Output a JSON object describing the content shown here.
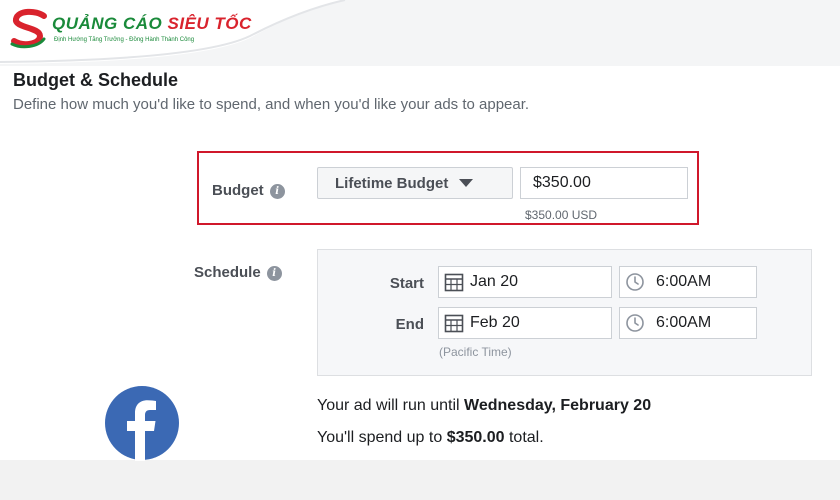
{
  "branding": {
    "name_part1": "QUẢNG CÁO",
    "name_part2": "SIÊU TỐC",
    "tagline": "Định Hướng Tăng Trưởng - Đồng Hành Thành Công",
    "colors": {
      "green": "#1a8a3a",
      "red": "#d9232d"
    }
  },
  "section": {
    "title": "Budget & Schedule",
    "subtitle": "Define how much you'd like to spend, and when you'd like your ads to appear."
  },
  "budget": {
    "label": "Budget",
    "type_dropdown": "Lifetime Budget",
    "amount": "$350.00",
    "currency_note": "$350.00 USD",
    "highlight_color": "#d0182b"
  },
  "schedule": {
    "label": "Schedule",
    "start_label": "Start",
    "start_date": "Jan 20",
    "start_time": "6:00AM",
    "end_label": "End",
    "end_date": "Feb 20",
    "end_time": "6:00AM",
    "timezone_note": "(Pacific Time)"
  },
  "summary": {
    "run_prefix": "Your ad will run until ",
    "run_until": "Wednesday, February 20",
    "spend_prefix": "You'll spend up to ",
    "spend_amount": "$350.00",
    "spend_suffix": " total."
  },
  "icons": {
    "info": "info-icon",
    "calendar": "calendar-icon",
    "clock": "clock-icon",
    "facebook": "facebook-logo-icon",
    "brand": "brand-logo-icon"
  }
}
